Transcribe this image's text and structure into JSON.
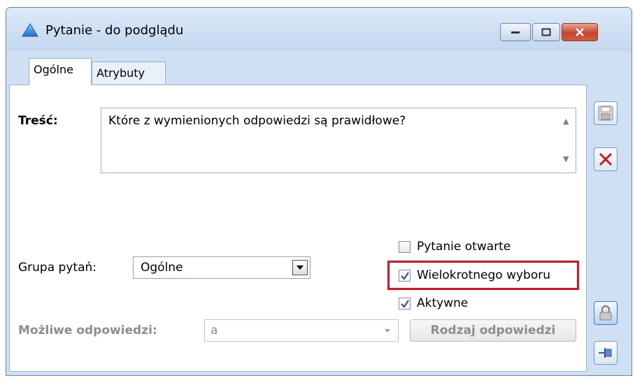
{
  "window": {
    "title": "Pytanie - do podglądu",
    "controls": [
      "minimize",
      "maximize",
      "close"
    ]
  },
  "tabs": [
    {
      "label": "Ogólne",
      "active": true
    },
    {
      "label": "Atrybuty",
      "active": false
    }
  ],
  "form": {
    "tresc_label": "Treść:",
    "tresc_value": "Które z wymienionych odpowiedzi są prawidłowe?",
    "grupa_label": "Grupa pytań:",
    "grupa_value": "Ogólne",
    "mozliwe_label": "Możliwe odpowiedzi:",
    "mozliwe_value": "a",
    "rodzaj_button": "Rodzaj odpowiedzi"
  },
  "checkboxes": [
    {
      "label": "Pytanie otwarte",
      "checked": false
    },
    {
      "label": "Wielokrotnego wyboru",
      "checked": true,
      "highlighted": true
    },
    {
      "label": "Aktywne",
      "checked": true
    }
  ],
  "side_buttons": [
    "save-icon",
    "cancel-icon",
    "lock-icon",
    "pin-icon"
  ],
  "colors": {
    "highlight": "#e0101e",
    "check": "#2a5db0",
    "cancel_x": "#d01818"
  }
}
